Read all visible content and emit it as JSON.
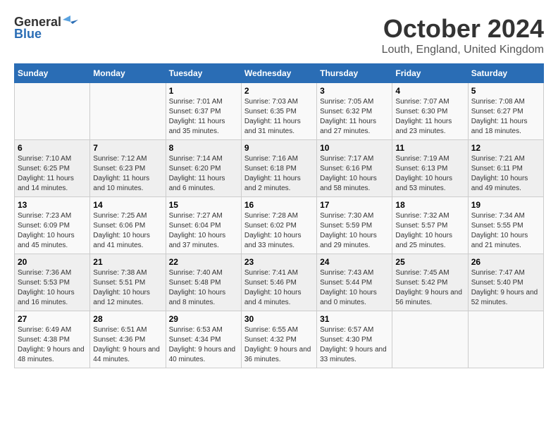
{
  "logo": {
    "general": "General",
    "blue": "Blue"
  },
  "title": "October 2024",
  "location": "Louth, England, United Kingdom",
  "days_header": [
    "Sunday",
    "Monday",
    "Tuesday",
    "Wednesday",
    "Thursday",
    "Friday",
    "Saturday"
  ],
  "weeks": [
    [
      {
        "day": "",
        "sunrise": "",
        "sunset": "",
        "daylight": ""
      },
      {
        "day": "",
        "sunrise": "",
        "sunset": "",
        "daylight": ""
      },
      {
        "day": "1",
        "sunrise": "Sunrise: 7:01 AM",
        "sunset": "Sunset: 6:37 PM",
        "daylight": "Daylight: 11 hours and 35 minutes."
      },
      {
        "day": "2",
        "sunrise": "Sunrise: 7:03 AM",
        "sunset": "Sunset: 6:35 PM",
        "daylight": "Daylight: 11 hours and 31 minutes."
      },
      {
        "day": "3",
        "sunrise": "Sunrise: 7:05 AM",
        "sunset": "Sunset: 6:32 PM",
        "daylight": "Daylight: 11 hours and 27 minutes."
      },
      {
        "day": "4",
        "sunrise": "Sunrise: 7:07 AM",
        "sunset": "Sunset: 6:30 PM",
        "daylight": "Daylight: 11 hours and 23 minutes."
      },
      {
        "day": "5",
        "sunrise": "Sunrise: 7:08 AM",
        "sunset": "Sunset: 6:27 PM",
        "daylight": "Daylight: 11 hours and 18 minutes."
      }
    ],
    [
      {
        "day": "6",
        "sunrise": "Sunrise: 7:10 AM",
        "sunset": "Sunset: 6:25 PM",
        "daylight": "Daylight: 11 hours and 14 minutes."
      },
      {
        "day": "7",
        "sunrise": "Sunrise: 7:12 AM",
        "sunset": "Sunset: 6:23 PM",
        "daylight": "Daylight: 11 hours and 10 minutes."
      },
      {
        "day": "8",
        "sunrise": "Sunrise: 7:14 AM",
        "sunset": "Sunset: 6:20 PM",
        "daylight": "Daylight: 11 hours and 6 minutes."
      },
      {
        "day": "9",
        "sunrise": "Sunrise: 7:16 AM",
        "sunset": "Sunset: 6:18 PM",
        "daylight": "Daylight: 11 hours and 2 minutes."
      },
      {
        "day": "10",
        "sunrise": "Sunrise: 7:17 AM",
        "sunset": "Sunset: 6:16 PM",
        "daylight": "Daylight: 10 hours and 58 minutes."
      },
      {
        "day": "11",
        "sunrise": "Sunrise: 7:19 AM",
        "sunset": "Sunset: 6:13 PM",
        "daylight": "Daylight: 10 hours and 53 minutes."
      },
      {
        "day": "12",
        "sunrise": "Sunrise: 7:21 AM",
        "sunset": "Sunset: 6:11 PM",
        "daylight": "Daylight: 10 hours and 49 minutes."
      }
    ],
    [
      {
        "day": "13",
        "sunrise": "Sunrise: 7:23 AM",
        "sunset": "Sunset: 6:09 PM",
        "daylight": "Daylight: 10 hours and 45 minutes."
      },
      {
        "day": "14",
        "sunrise": "Sunrise: 7:25 AM",
        "sunset": "Sunset: 6:06 PM",
        "daylight": "Daylight: 10 hours and 41 minutes."
      },
      {
        "day": "15",
        "sunrise": "Sunrise: 7:27 AM",
        "sunset": "Sunset: 6:04 PM",
        "daylight": "Daylight: 10 hours and 37 minutes."
      },
      {
        "day": "16",
        "sunrise": "Sunrise: 7:28 AM",
        "sunset": "Sunset: 6:02 PM",
        "daylight": "Daylight: 10 hours and 33 minutes."
      },
      {
        "day": "17",
        "sunrise": "Sunrise: 7:30 AM",
        "sunset": "Sunset: 5:59 PM",
        "daylight": "Daylight: 10 hours and 29 minutes."
      },
      {
        "day": "18",
        "sunrise": "Sunrise: 7:32 AM",
        "sunset": "Sunset: 5:57 PM",
        "daylight": "Daylight: 10 hours and 25 minutes."
      },
      {
        "day": "19",
        "sunrise": "Sunrise: 7:34 AM",
        "sunset": "Sunset: 5:55 PM",
        "daylight": "Daylight: 10 hours and 21 minutes."
      }
    ],
    [
      {
        "day": "20",
        "sunrise": "Sunrise: 7:36 AM",
        "sunset": "Sunset: 5:53 PM",
        "daylight": "Daylight: 10 hours and 16 minutes."
      },
      {
        "day": "21",
        "sunrise": "Sunrise: 7:38 AM",
        "sunset": "Sunset: 5:51 PM",
        "daylight": "Daylight: 10 hours and 12 minutes."
      },
      {
        "day": "22",
        "sunrise": "Sunrise: 7:40 AM",
        "sunset": "Sunset: 5:48 PM",
        "daylight": "Daylight: 10 hours and 8 minutes."
      },
      {
        "day": "23",
        "sunrise": "Sunrise: 7:41 AM",
        "sunset": "Sunset: 5:46 PM",
        "daylight": "Daylight: 10 hours and 4 minutes."
      },
      {
        "day": "24",
        "sunrise": "Sunrise: 7:43 AM",
        "sunset": "Sunset: 5:44 PM",
        "daylight": "Daylight: 10 hours and 0 minutes."
      },
      {
        "day": "25",
        "sunrise": "Sunrise: 7:45 AM",
        "sunset": "Sunset: 5:42 PM",
        "daylight": "Daylight: 9 hours and 56 minutes."
      },
      {
        "day": "26",
        "sunrise": "Sunrise: 7:47 AM",
        "sunset": "Sunset: 5:40 PM",
        "daylight": "Daylight: 9 hours and 52 minutes."
      }
    ],
    [
      {
        "day": "27",
        "sunrise": "Sunrise: 6:49 AM",
        "sunset": "Sunset: 4:38 PM",
        "daylight": "Daylight: 9 hours and 48 minutes."
      },
      {
        "day": "28",
        "sunrise": "Sunrise: 6:51 AM",
        "sunset": "Sunset: 4:36 PM",
        "daylight": "Daylight: 9 hours and 44 minutes."
      },
      {
        "day": "29",
        "sunrise": "Sunrise: 6:53 AM",
        "sunset": "Sunset: 4:34 PM",
        "daylight": "Daylight: 9 hours and 40 minutes."
      },
      {
        "day": "30",
        "sunrise": "Sunrise: 6:55 AM",
        "sunset": "Sunset: 4:32 PM",
        "daylight": "Daylight: 9 hours and 36 minutes."
      },
      {
        "day": "31",
        "sunrise": "Sunrise: 6:57 AM",
        "sunset": "Sunset: 4:30 PM",
        "daylight": "Daylight: 9 hours and 33 minutes."
      },
      {
        "day": "",
        "sunrise": "",
        "sunset": "",
        "daylight": ""
      },
      {
        "day": "",
        "sunrise": "",
        "sunset": "",
        "daylight": ""
      }
    ]
  ]
}
